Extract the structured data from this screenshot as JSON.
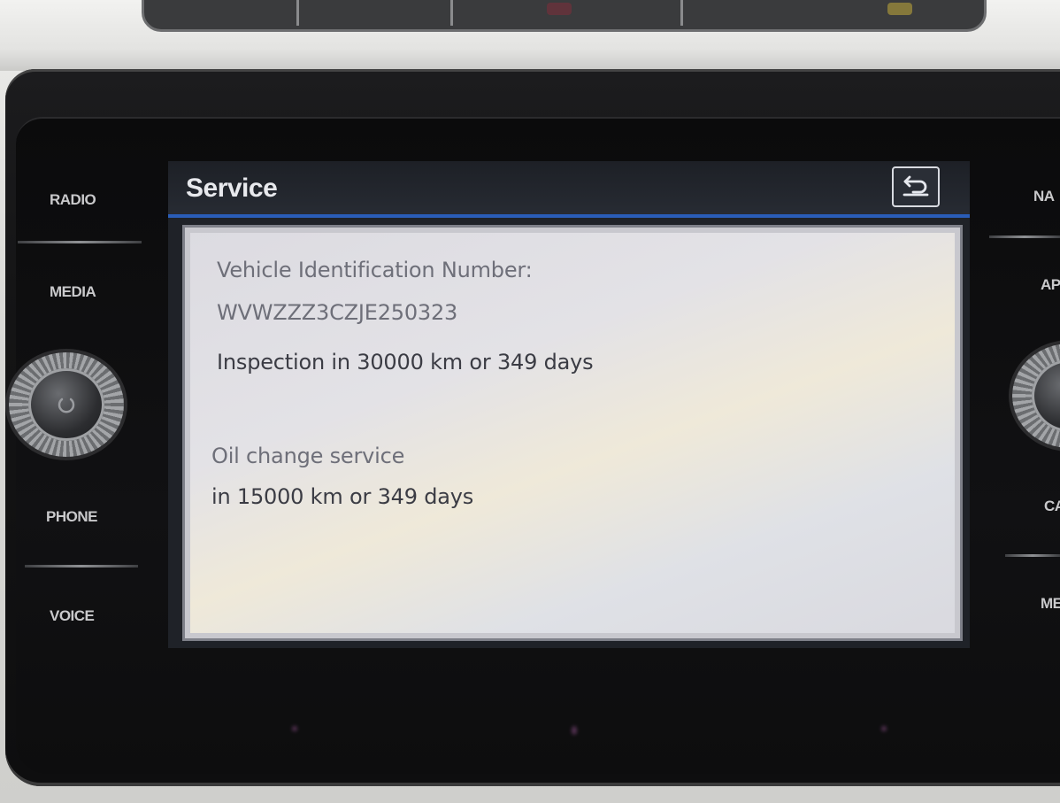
{
  "side_buttons_left": [
    {
      "label": "RADIO"
    },
    {
      "label": "MEDIA"
    },
    {
      "label": "PHONE"
    },
    {
      "label": "VOICE"
    }
  ],
  "side_buttons_right": [
    {
      "label": "NA"
    },
    {
      "label": "AP"
    },
    {
      "label": "CA"
    },
    {
      "label": "ME"
    }
  ],
  "screen": {
    "title": "Service",
    "back_icon": "back-arrow-icon",
    "vin_label": "Vehicle Identification Number:",
    "vin_value": "WVWZZZ3CZJE250323",
    "inspection": "Inspection in 30000 km or 349 days",
    "oil_line1": "Oil change service",
    "oil_line2": "in 15000 km or 349 days"
  },
  "colors": {
    "header_accent": "#2a5db8",
    "dialog_bg": "#e3e2e6",
    "text": "#3b3c44"
  }
}
